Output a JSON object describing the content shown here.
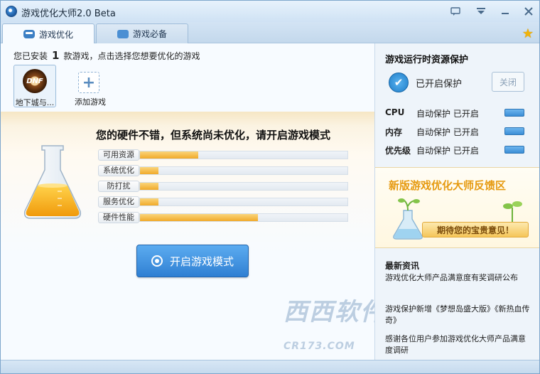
{
  "window": {
    "title": "游戏优化大师2.0 Beta"
  },
  "tabs": [
    {
      "label": "游戏优化",
      "active": true
    },
    {
      "label": "游戏必备",
      "active": false
    }
  ],
  "installed": {
    "prefix": "您已安装",
    "count": "1",
    "suffix": "款游戏，点击选择您想要优化的游戏"
  },
  "games": [
    {
      "name": "地下城与...",
      "logo_text": "DNF"
    }
  ],
  "add_game_label": "添加游戏",
  "headline": "您的硬件不错，但系统尚未优化，请开启游戏模式",
  "metrics": [
    {
      "label": "可用资源",
      "percent": 28
    },
    {
      "label": "系统优化",
      "percent": 9
    },
    {
      "label": "防打扰",
      "percent": 9
    },
    {
      "label": "服务优化",
      "percent": 9
    },
    {
      "label": "硬件性能",
      "percent": 57
    }
  ],
  "start_button": "开启游戏模式",
  "watermark": {
    "text": "西西软件",
    "sub": "CR173.COM"
  },
  "protection": {
    "title": "游戏运行时资源保护",
    "status": "已开启保护",
    "close_label": "关闭",
    "rows": [
      {
        "key": "CPU",
        "value": "自动保护  已开启"
      },
      {
        "key": "内存",
        "value": "自动保护  已开启"
      },
      {
        "key": "优先级",
        "value": "自动保护  已开启"
      }
    ]
  },
  "feedback": {
    "title": "新版游戏优化大师反馈区",
    "button": "期待您的宝贵意见！"
  },
  "news": {
    "title": "最新资讯",
    "items": [
      "游戏优化大师产品满意度有奖调研公布",
      "游戏保护新增《梦想岛盛大版》《新热血传奇》",
      "感谢各位用户参加游戏优化大师产品满意度调研"
    ]
  },
  "colors": {
    "accent": "#2f7fd3",
    "bar": "#f1aa2a",
    "feedback": "#e69a10"
  }
}
